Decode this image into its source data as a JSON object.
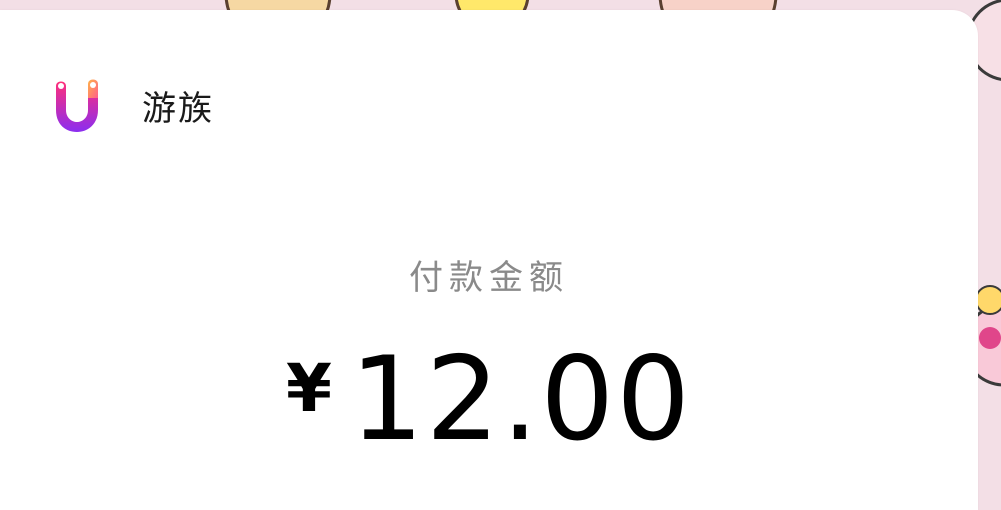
{
  "brand": {
    "name": "游族",
    "logo_icon": "youzu-logo-icon",
    "logo_colors": [
      "#ff3d7f",
      "#8a2be2",
      "#ffb347"
    ]
  },
  "payment": {
    "label": "付款金额",
    "currency": "¥",
    "amount": "12.00"
  },
  "colors": {
    "background": "#f3dfe6",
    "card": "#ffffff",
    "label": "#8a8a8a",
    "amount": "#000000"
  }
}
